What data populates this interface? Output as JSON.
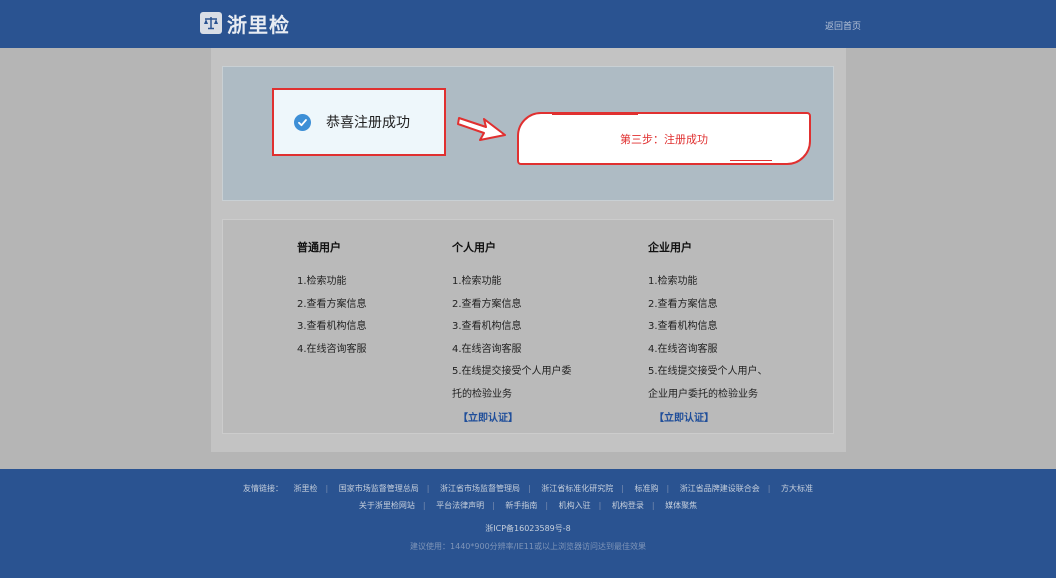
{
  "header": {
    "logo_text": "浙里检",
    "back_home": "返回首页"
  },
  "success": {
    "message": "恭喜注册成功",
    "step_label": "第三步：注册成功"
  },
  "columns": [
    {
      "title": "普通用户",
      "items": [
        "1.检索功能",
        "2.查看方案信息",
        "3.查看机构信息",
        "4.在线咨询客服"
      ]
    },
    {
      "title": "个人用户",
      "items": [
        "1.检索功能",
        "2.查看方案信息",
        "3.查看机构信息",
        "4.在线咨询客服",
        "5.在线提交接受个人用户委",
        "托的检验业务"
      ],
      "link": "【立即认证】"
    },
    {
      "title": "企业用户",
      "items": [
        "1.检索功能",
        "2.查看方案信息",
        "3.查看机构信息",
        "4.在线咨询客服",
        "5.在线提交接受个人用户、",
        "企业用户委托的检验业务"
      ],
      "link": "【立即认证】"
    }
  ],
  "footer": {
    "friend_label": "友情链接：",
    "links_row1": [
      "浙里检",
      "国家市场监督管理总局",
      "浙江省市场监督管理局",
      "浙江省标准化研究院",
      "标准购",
      "浙江省品牌建设联合会",
      "方大标准"
    ],
    "links_row2": [
      "关于浙里检网站",
      "平台法律声明",
      "新手指南",
      "机构入驻",
      "机构登录",
      "媒体聚焦"
    ],
    "icp": "浙ICP备16023589号-8",
    "hint": "建议使用：1440*900分辨率/IE11或以上浏览器访问达到最佳效果"
  },
  "colors": {
    "header_bg": "#2a5391",
    "accent_red": "#e03030",
    "check_blue": "#3d8fd6",
    "link_blue": "#1f4e9a"
  },
  "icons": {
    "logo": "scales-icon",
    "success": "check-circle-icon",
    "pointer": "arrow-right-icon"
  }
}
